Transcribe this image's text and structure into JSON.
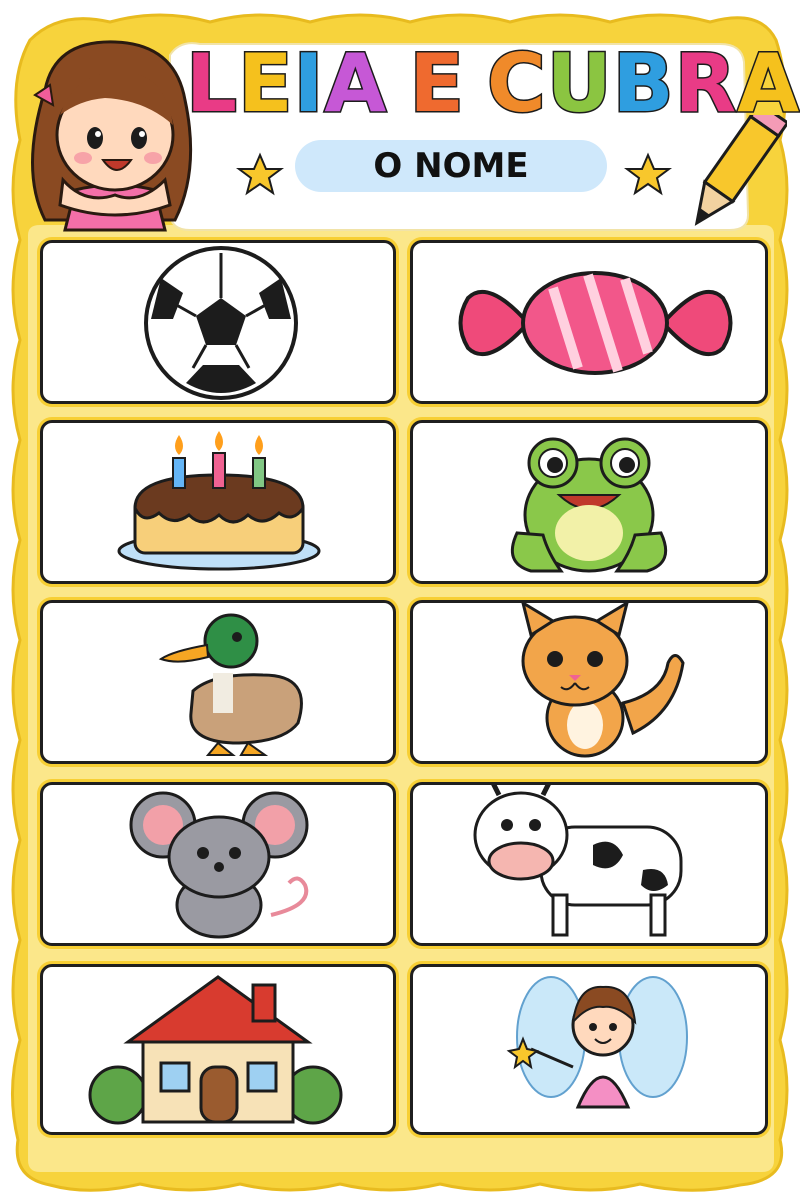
{
  "title": {
    "line1_letters": [
      {
        "char": "L",
        "color": "#e93b86"
      },
      {
        "char": "E",
        "color": "#f5c11d"
      },
      {
        "char": "I",
        "color": "#2f9ee0"
      },
      {
        "char": "A",
        "color": "#c658d6"
      },
      {
        "char": " ",
        "color": "#000000"
      },
      {
        "char": "E",
        "color": "#ef6a2f"
      },
      {
        "char": " ",
        "color": "#000000"
      },
      {
        "char": "C",
        "color": "#f08a2a"
      },
      {
        "char": "U",
        "color": "#8bc541"
      },
      {
        "char": "B",
        "color": "#2f9ee0"
      },
      {
        "char": "R",
        "color": "#e93b86"
      },
      {
        "char": "A",
        "color": "#f5c11d"
      }
    ],
    "subtitle": "O NOME"
  },
  "colors": {
    "frame": "#f7d33c",
    "frame_inner": "#fbe78a",
    "card_border": "#1f1f1f",
    "pill": "#cfe8fb"
  },
  "cards": [
    {
      "icon": "soccer-ball-icon"
    },
    {
      "icon": "candy-icon"
    },
    {
      "icon": "birthday-cake-icon"
    },
    {
      "icon": "frog-icon"
    },
    {
      "icon": "duck-icon"
    },
    {
      "icon": "cat-icon"
    },
    {
      "icon": "mouse-icon"
    },
    {
      "icon": "cow-icon"
    },
    {
      "icon": "house-icon"
    },
    {
      "icon": "fairy-icon"
    }
  ]
}
